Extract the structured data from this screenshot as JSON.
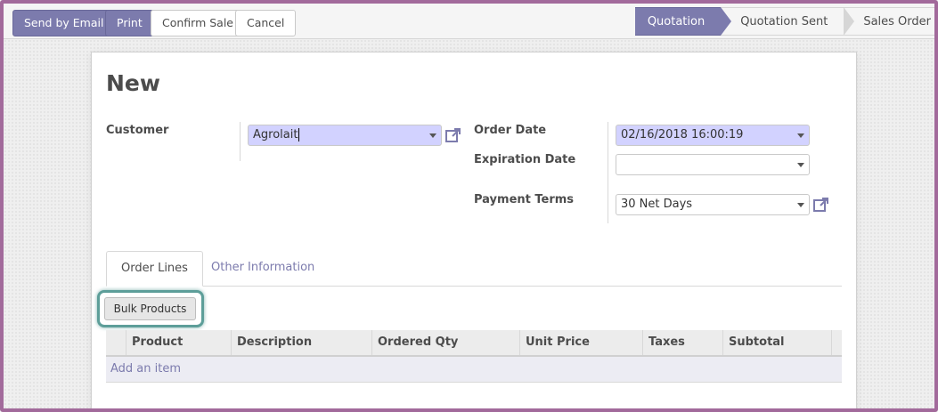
{
  "toolbar": {
    "send_email": "Send by Email",
    "print": "Print",
    "confirm_sale": "Confirm Sale",
    "cancel": "Cancel"
  },
  "statusbar": {
    "stages": [
      "Quotation",
      "Quotation Sent",
      "Sales Order"
    ],
    "active": "Quotation"
  },
  "form": {
    "title": "New",
    "customer_label": "Customer",
    "customer_value": "Agrolait",
    "order_date_label": "Order Date",
    "order_date_value": "02/16/2018 16:00:19",
    "expiration_date_label": "Expiration Date",
    "expiration_date_value": "",
    "payment_terms_label": "Payment Terms",
    "payment_terms_value": "30 Net Days"
  },
  "tabs": {
    "order_lines": "Order Lines",
    "other_info": "Other Information"
  },
  "bulk_button": "Bulk Products",
  "table": {
    "columns": [
      "Product",
      "Description",
      "Ordered Qty",
      "Unit Price",
      "Taxes",
      "Subtotal"
    ],
    "add_item": "Add an item"
  },
  "colors": {
    "primary": "#7c7bad",
    "highlight_ring": "#5d9e99",
    "frame": "#a26a9b",
    "required_field": "#d2d2ff"
  },
  "icons": {
    "external_link": "external-link-icon",
    "dropdown": "chevron-down-icon"
  }
}
